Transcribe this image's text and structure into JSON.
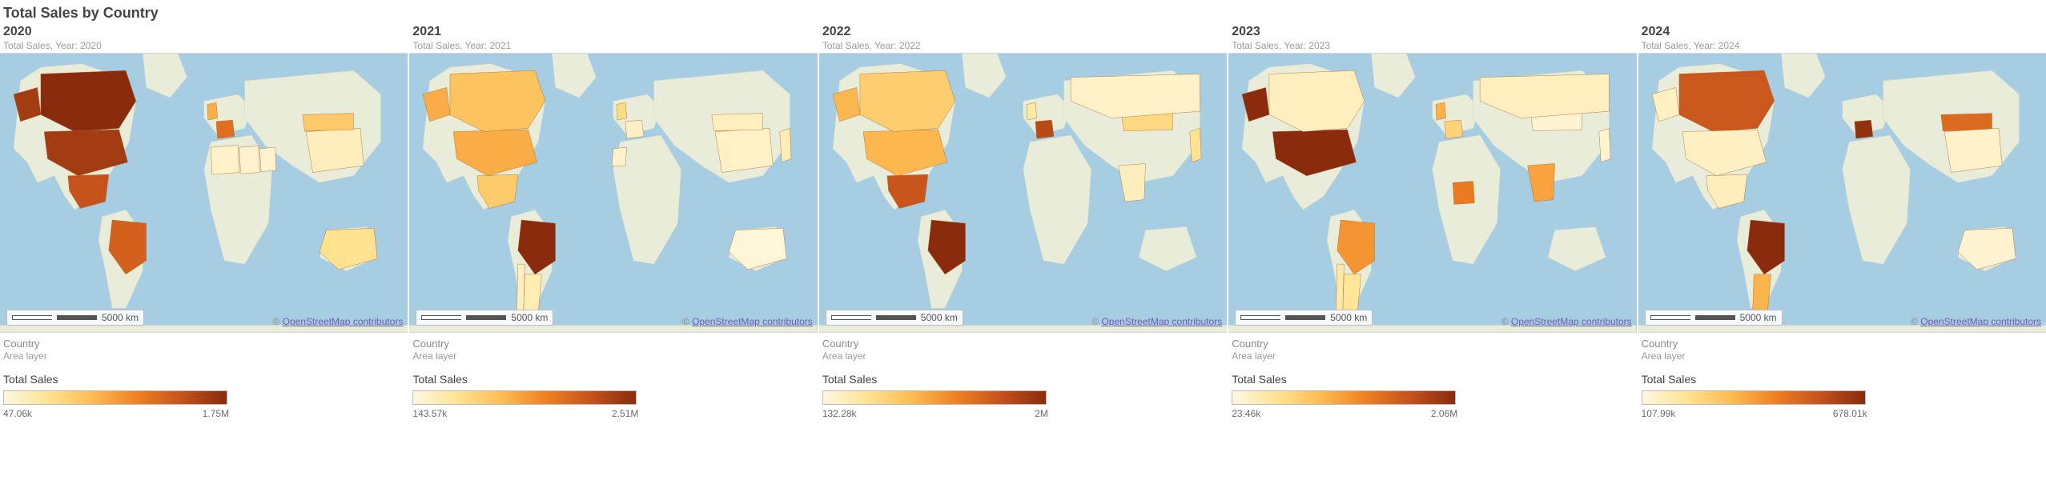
{
  "dashboard": {
    "title": "Total Sales by Country"
  },
  "common": {
    "scale_label": "5000 km",
    "attribution_prefix": "© ",
    "attribution_link": "OpenStreetMap contributors",
    "legend_country": "Country",
    "legend_area": "Area layer",
    "legend_metric": "Total Sales"
  },
  "panels": [
    {
      "year": "2020",
      "subtitle": "Total Sales, Year: 2020",
      "legend_min": "47.06k",
      "legend_max": "1.75M"
    },
    {
      "year": "2021",
      "subtitle": "Total Sales, Year: 2021",
      "legend_min": "143.57k",
      "legend_max": "2.51M"
    },
    {
      "year": "2022",
      "subtitle": "Total Sales, Year: 2022",
      "legend_min": "132.28k",
      "legend_max": "2M"
    },
    {
      "year": "2023",
      "subtitle": "Total Sales, Year: 2023",
      "legend_min": "23.46k",
      "legend_max": "2.06M"
    },
    {
      "year": "2024",
      "subtitle": "Total Sales, Year: 2024",
      "legend_min": "107.99k",
      "legend_max": "678.01k"
    }
  ],
  "chart_data": [
    {
      "year": 2020,
      "type": "choropleth-map",
      "metric": "Total Sales",
      "scale_min": 47060,
      "scale_max": 1750000,
      "countries": {
        "Canada": 1750000,
        "United States": 1600000,
        "Mexico": 1400000,
        "Brazil": 1300000,
        "Australia": 400000,
        "United Kingdom": 800000,
        "France": 1200000,
        "China": 200000,
        "Mongolia": 600000,
        "Algeria": 150000,
        "Libya": 130000,
        "Egypt": 120000
      }
    },
    {
      "year": 2021,
      "type": "choropleth-map",
      "metric": "Total Sales",
      "scale_min": 143570,
      "scale_max": 2510000,
      "countries": {
        "Brazil": 2510000,
        "United States": 1200000,
        "Canada": 1000000,
        "Mexico": 900000,
        "Argentina": 400000,
        "Chile": 350000,
        "Australia": 200000,
        "United Kingdom": 700000,
        "France": 300000,
        "Morocco": 250000,
        "Japan": 400000,
        "China": 300000,
        "Mongolia": 350000
      }
    },
    {
      "year": 2022,
      "type": "choropleth-map",
      "metric": "Total Sales",
      "scale_min": 132280,
      "scale_max": 2000000,
      "countries": {
        "Brazil": 2000000,
        "Mexico": 1600000,
        "United States": 900000,
        "Canada": 700000,
        "France": 1700000,
        "United Kingdom": 400000,
        "India": 300000,
        "Mongolia": 600000,
        "Japan": 500000,
        "Russia": 250000
      }
    },
    {
      "year": 2023,
      "type": "choropleth-map",
      "metric": "Total Sales",
      "scale_min": 23460,
      "scale_max": 2060000,
      "countries": {
        "United States": 2060000,
        "Brazil": 1100000,
        "Argentina": 400000,
        "Chile": 300000,
        "Nigeria": 1300000,
        "France": 600000,
        "United Kingdom": 900000,
        "India": 1000000,
        "Mongolia": 100000,
        "Japan": 100000,
        "Canada": 200000,
        "Russia": 200000
      }
    },
    {
      "year": 2024,
      "type": "choropleth-map",
      "metric": "Total Sales",
      "scale_min": 107990,
      "scale_max": 678010,
      "countries": {
        "Brazil": 678010,
        "France": 660000,
        "Canada": 550000,
        "Mongolia": 500000,
        "Argentina": 350000,
        "United States": 150000,
        "Mexico": 160000,
        "Australia": 130000,
        "China": 140000
      }
    }
  ]
}
